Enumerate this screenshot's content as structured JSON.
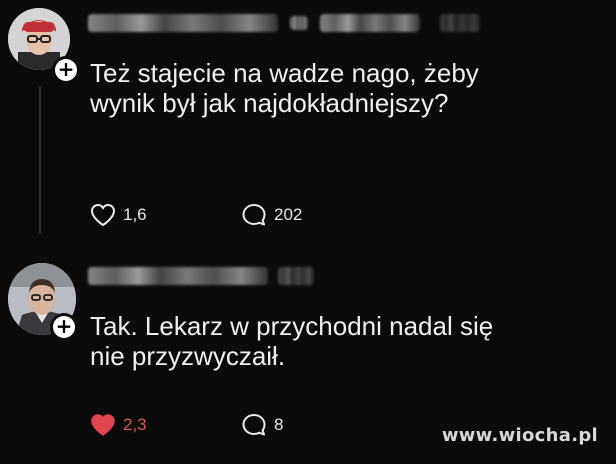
{
  "posts": [
    {
      "text": "Też stajecie na wadze nago, żeby\nwynik był jak najdokładniejszy?",
      "likes": "1,6",
      "comments": "202",
      "liked": false
    },
    {
      "text": "Tak. Lekarz w przychodni nadal się\nnie przyzwyczaił.",
      "likes": "2,3",
      "comments": "8",
      "liked": true
    }
  ],
  "follow_symbol": "+",
  "watermark": "www.wiocha.pl",
  "colors": {
    "background": "#0b0b0b",
    "text": "#efefef",
    "liked_heart": "#e0444f",
    "liked_count": "#d75454"
  },
  "icons": [
    "avatar",
    "follow-plus-icon",
    "heart-icon",
    "heart-filled-icon",
    "comment-bubble-icon"
  ]
}
